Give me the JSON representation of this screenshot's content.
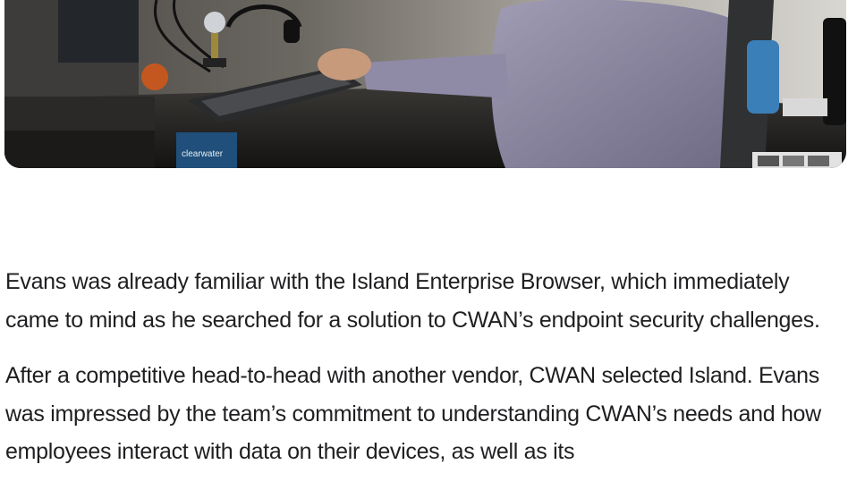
{
  "hero": {
    "icon": "office-photo",
    "tag_text": "clearwater",
    "colors": {
      "wall": "#5d5a55",
      "desk": "#1a1816",
      "shirt": "#8e8aa4",
      "keyboard": "#2a2b2d",
      "bottle": "#3b7fb8"
    }
  },
  "article": {
    "paragraphs": [
      "Evans was already familiar with the Island Enterprise Browser, which immediately came to mind as he searched for a solution to CWAN’s endpoint security challenges.",
      "After a competitive head-to-head with another vendor, CWAN selected Island. Evans was impressed by the team’s commitment to understanding CWAN’s needs and how employees interact with data on their devices, as well as its"
    ]
  }
}
